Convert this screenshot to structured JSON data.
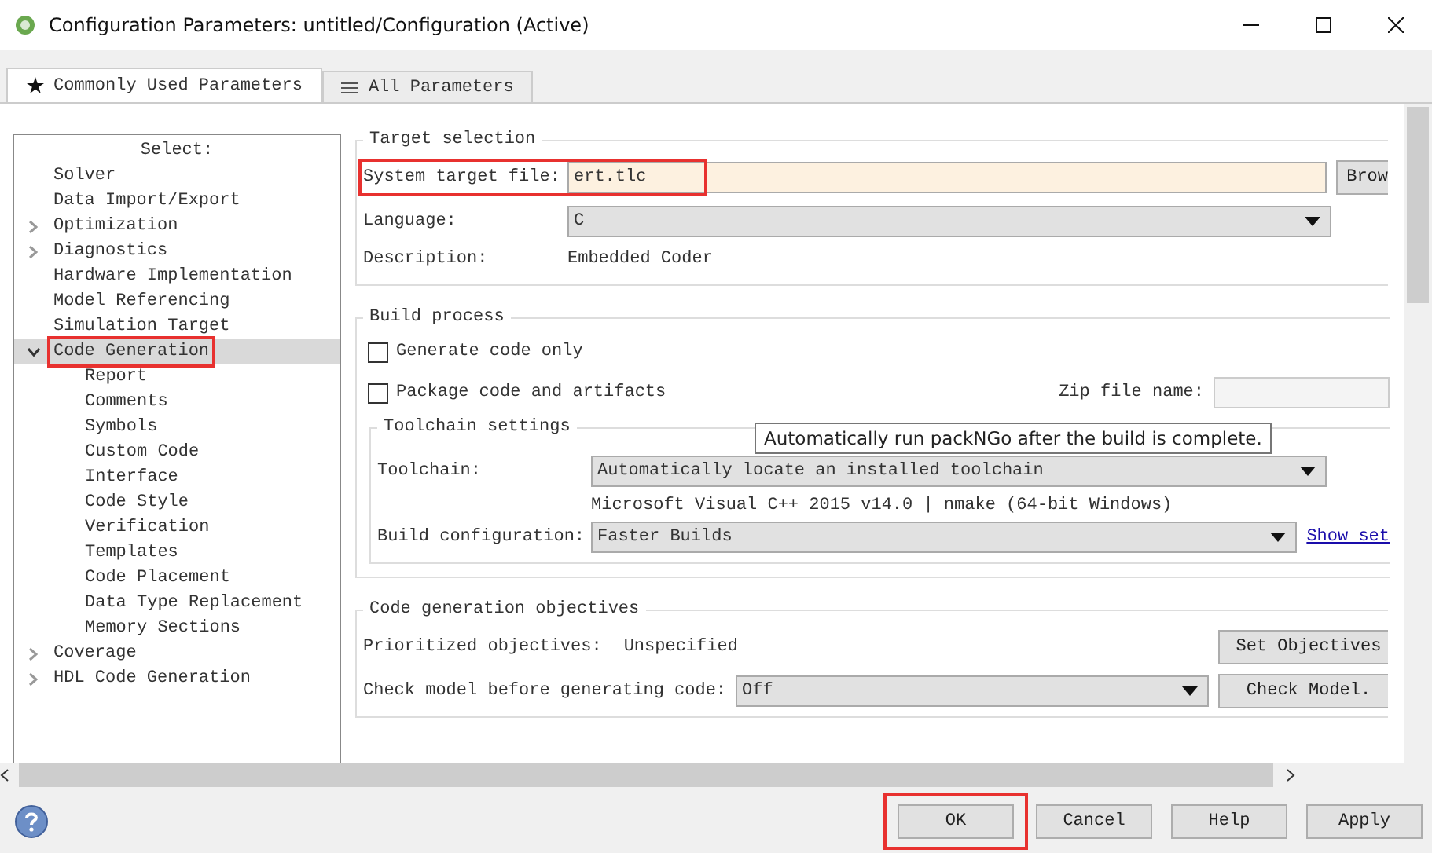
{
  "window": {
    "title": "Configuration Parameters: untitled/Configuration (Active)"
  },
  "tabs": [
    {
      "label": "Commonly Used Parameters",
      "selected": true
    },
    {
      "label": "All Parameters",
      "selected": false
    }
  ],
  "tree": {
    "heading": "Select:",
    "items": [
      {
        "label": "Solver",
        "kind": "page",
        "selected": false
      },
      {
        "label": "Data Import/Export",
        "kind": "page",
        "selected": false
      },
      {
        "label": "Optimization",
        "kind": "group",
        "expanded": false,
        "selected": false
      },
      {
        "label": "Diagnostics",
        "kind": "group",
        "expanded": false,
        "selected": false
      },
      {
        "label": "Hardware Implementation",
        "kind": "page",
        "selected": false
      },
      {
        "label": "Model Referencing",
        "kind": "page",
        "selected": false
      },
      {
        "label": "Simulation Target",
        "kind": "page",
        "selected": false
      },
      {
        "label": "Code Generation",
        "kind": "group",
        "expanded": true,
        "selected": true,
        "highlighted": true,
        "children": [
          {
            "label": "Report",
            "kind": "page",
            "selected": false
          },
          {
            "label": "Comments",
            "kind": "page",
            "selected": false
          },
          {
            "label": "Symbols",
            "kind": "page",
            "selected": false
          },
          {
            "label": "Custom Code",
            "kind": "page",
            "selected": false
          },
          {
            "label": "Interface",
            "kind": "page",
            "selected": false
          },
          {
            "label": "Code Style",
            "kind": "page",
            "selected": false
          },
          {
            "label": "Verification",
            "kind": "page",
            "selected": false
          },
          {
            "label": "Templates",
            "kind": "page",
            "selected": false
          },
          {
            "label": "Code Placement",
            "kind": "page",
            "selected": false
          },
          {
            "label": "Data Type Replacement",
            "kind": "page",
            "selected": false
          },
          {
            "label": "Memory Sections",
            "kind": "page",
            "selected": false
          }
        ]
      },
      {
        "label": "Coverage",
        "kind": "group",
        "expanded": false,
        "selected": false
      },
      {
        "label": "HDL Code Generation",
        "kind": "group",
        "expanded": false,
        "selected": false
      }
    ]
  },
  "target_selection": {
    "title": "Target selection",
    "system_target_file": {
      "label": "System target file:",
      "value": "ert.tlc",
      "highlighted": true
    },
    "browse_button": "Brow",
    "language": {
      "label": "Language:",
      "value": "C"
    },
    "description": {
      "label": "Description:",
      "value": "Embedded Coder"
    }
  },
  "build_process": {
    "title": "Build process",
    "checkboxes": [
      {
        "label": "Generate code only",
        "checked": false
      },
      {
        "label": "Package code and artifacts",
        "checked": false
      }
    ],
    "zip_file_name": {
      "label": "Zip file name:"
    },
    "toolchain_settings": {
      "title": "Toolchain settings",
      "toolchain": {
        "label": "Toolchain:",
        "value": "Automatically locate an installed toolchain"
      },
      "toolchain_info": "Microsoft Visual C++ 2015 v14.0 | nmake (64-bit Windows)",
      "build_configuration": {
        "label": "Build configuration:",
        "value": "Faster Builds"
      },
      "show_settings_link": "Show set"
    }
  },
  "objectives": {
    "title": "Code generation objectives",
    "prioritized": {
      "label": "Prioritized objectives:",
      "value": "Unspecified"
    },
    "set_objectives_button": "Set Objectives",
    "check_model": {
      "label": "Check model before generating code:",
      "value": "Off"
    },
    "check_model_button": "Check Model."
  },
  "tooltip": "Automatically run packNGo after the build is complete.",
  "buttons": [
    {
      "label": "OK",
      "highlighted": true
    },
    {
      "label": "Cancel"
    },
    {
      "label": "Help"
    },
    {
      "label": "Apply"
    }
  ]
}
